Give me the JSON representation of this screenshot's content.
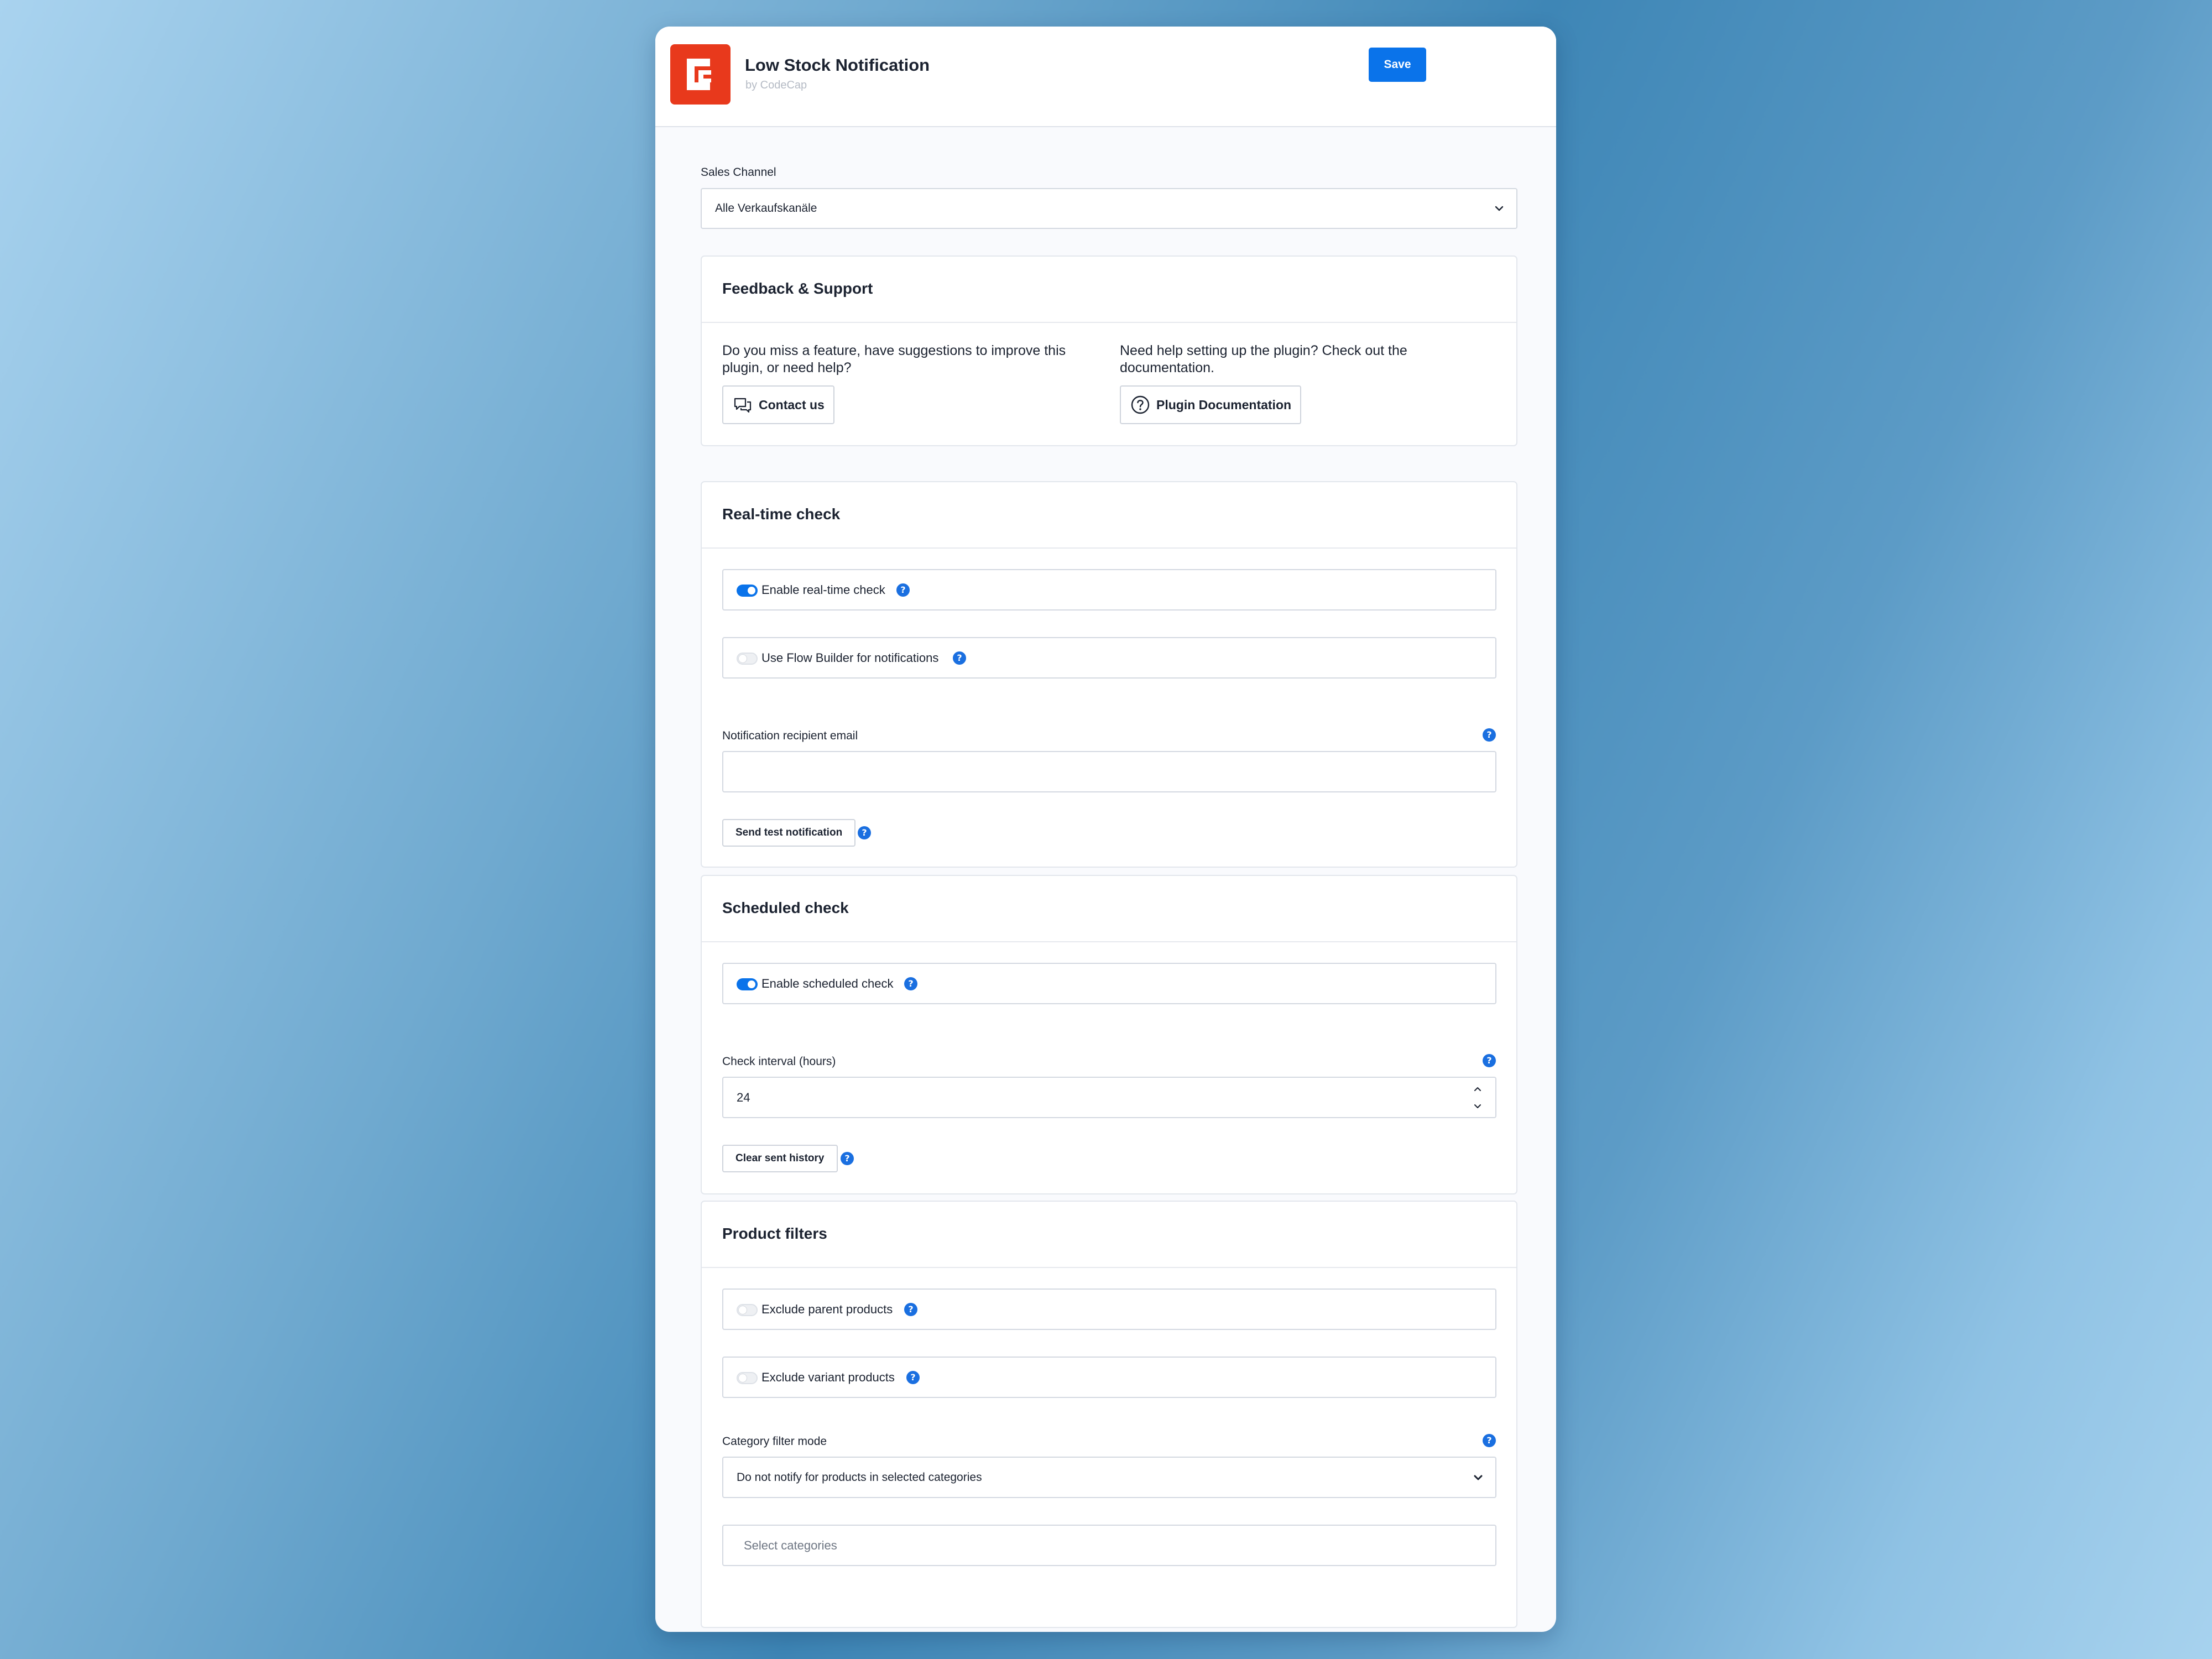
{
  "header": {
    "title": "Low Stock Notification",
    "subtitle": "by CodeCap",
    "save_label": "Save"
  },
  "sales_channel": {
    "label": "Sales Channel",
    "value": "Alle Verkaufskanäle"
  },
  "feedback": {
    "title": "Feedback & Support",
    "left_text": "Do you miss a feature, have suggestions to improve this plugin, or need help?",
    "contact_label": "Contact us",
    "right_text": "Need help setting up the plugin? Check out the documentation.",
    "docs_label": "Plugin Documentation"
  },
  "realtime": {
    "title": "Real-time check",
    "enable_label": "Enable real-time check",
    "enable_on": true,
    "flow_label": "Use Flow Builder for notifications",
    "flow_on": false,
    "email_label": "Notification recipient email",
    "email_value": "",
    "test_label": "Send test notification"
  },
  "scheduled": {
    "title": "Scheduled check",
    "enable_label": "Enable scheduled check",
    "enable_on": true,
    "interval_label": "Check interval (hours)",
    "interval_value": "24",
    "clear_label": "Clear sent history"
  },
  "filters": {
    "title": "Product filters",
    "parent_label": "Exclude parent products",
    "parent_on": false,
    "variant_label": "Exclude variant products",
    "variant_on": false,
    "mode_label": "Category filter mode",
    "mode_value": "Do not notify for products in selected categories",
    "categories_placeholder": "Select categories"
  },
  "help_glyph": "?",
  "colors": {
    "accent": "#0a73ea",
    "logo": "#e8391c",
    "help": "#1a6fe0"
  }
}
